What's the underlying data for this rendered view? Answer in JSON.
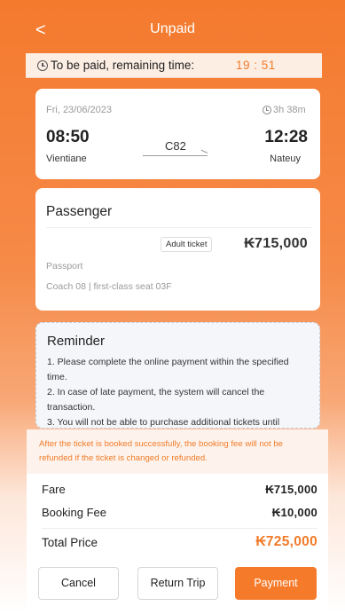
{
  "header": {
    "back_icon": "chevron-left-icon",
    "back_glyph": "<",
    "title": "Unpaid"
  },
  "payment_timer": {
    "icon": "clock-icon",
    "label": "To be paid, remaining time:",
    "value": "19 : 51"
  },
  "trip": {
    "date": "Fri, 23/06/2023",
    "duration_icon": "clock-icon",
    "duration": "3h 38m",
    "departure_time": "08:50",
    "arrival_time": "12:28",
    "train_number": "C82",
    "departure_station": "Vientiane",
    "arrival_station": "Nateuy"
  },
  "passenger": {
    "title": "Passenger",
    "ticket_type": "Adult ticket",
    "price": "₭715,000",
    "document_type": "Passport",
    "seat": "Coach 08 | first-class seat 03F"
  },
  "reminder": {
    "title": "Reminder",
    "items": [
      "1. Please complete the online payment within the specified time.",
      "2. In case of late payment, the system will cancel the transaction.",
      "3. You will not be able to purchase additional tickets until"
    ]
  },
  "checkout": {
    "notice": "After the ticket is booked successfully, the booking fee will not be refunded if the ticket is changed or refunded.",
    "fare_label": "Fare",
    "fare_value": "₭715,000",
    "booking_fee_label": "Booking Fee",
    "booking_fee_value": "₭10,000",
    "total_label": "Total Price",
    "total_value": "₭725,000",
    "cancel_label": "Cancel",
    "return_trip_label": "Return Trip",
    "payment_label": "Payment"
  },
  "colors": {
    "accent": "#f57a2a",
    "header_top": "#f47a2e",
    "notice_bg": "#fdf3ec"
  }
}
